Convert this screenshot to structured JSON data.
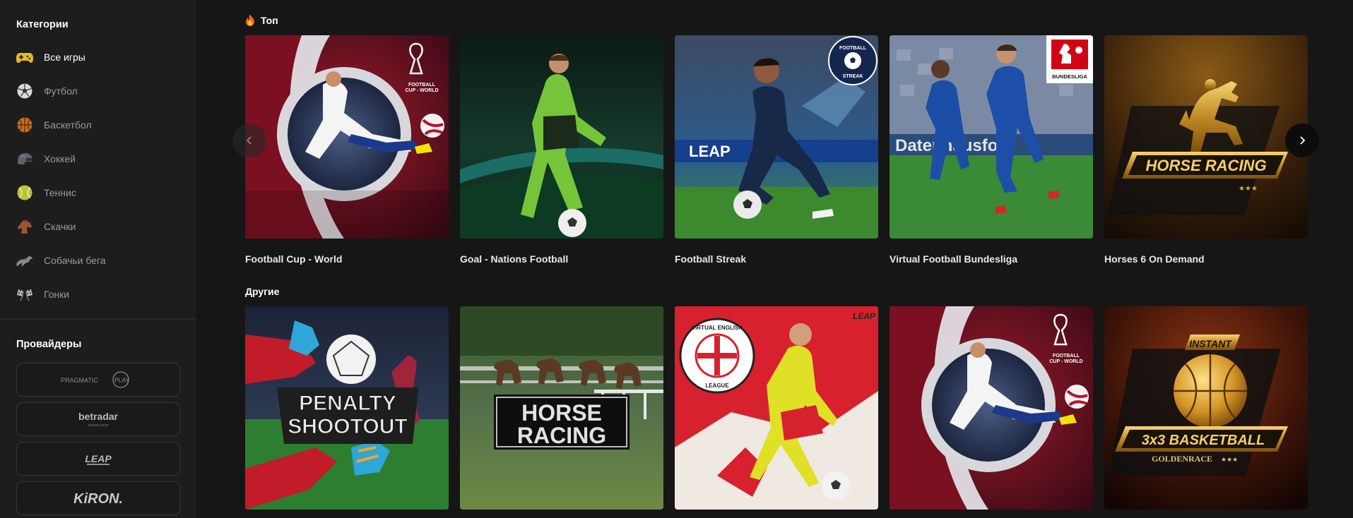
{
  "sidebar": {
    "categories_title": "Категории",
    "categories": [
      {
        "label": "Все игры",
        "icon": "gamepad-icon",
        "active": true
      },
      {
        "label": "Футбол",
        "icon": "soccer-ball-icon"
      },
      {
        "label": "Баскетбол",
        "icon": "basketball-icon"
      },
      {
        "label": "Хоккей",
        "icon": "hockey-helmet-icon"
      },
      {
        "label": "Теннис",
        "icon": "tennis-ball-icon"
      },
      {
        "label": "Скачки",
        "icon": "horse-head-icon"
      },
      {
        "label": "Собачьи бега",
        "icon": "greyhound-icon"
      },
      {
        "label": "Гонки",
        "icon": "racing-flags-icon"
      }
    ],
    "providers_title": "Провайдеры",
    "providers": [
      {
        "name": "PRAGMATIC PLAY",
        "logo_text": "PRAGMATIC",
        "logo_badge": "PLAY"
      },
      {
        "name": "betradar",
        "logo_text": "betradar",
        "logo_sub": "dreamy faces"
      },
      {
        "name": "LEAP",
        "logo_text": "LEAP"
      },
      {
        "name": "KIRON",
        "logo_text": "KiRON."
      }
    ]
  },
  "sections": {
    "top": {
      "title": "Топ",
      "icon": "fire-icon",
      "games": [
        {
          "title": "Football Cup - World",
          "badge": "FOOTBALL CUP - WORLD"
        },
        {
          "title": "Goal - Nations Football"
        },
        {
          "title": "Football Streak",
          "badge": "FOOTBALL STREAK"
        },
        {
          "title": "Virtual Football Bundesliga",
          "badge": "BUNDESLIGA"
        },
        {
          "title": "Horses 6 On Demand",
          "badge": "HORSE RACING"
        }
      ]
    },
    "other": {
      "title": "Другие",
      "games": [
        {
          "art_text": [
            "PENALTY",
            "SHOOTOUT"
          ]
        },
        {
          "art_text": [
            "HORSE",
            "RACING"
          ]
        },
        {
          "art_text": [
            "VIRTUAL ENGLISH LEAGUE",
            "LEAP"
          ]
        },
        {
          "badge": "FOOTBALL CUP - WORLD"
        },
        {
          "art_text": [
            "INSTANT",
            "3x3 BASKETBALL",
            "GOLDENRACE"
          ]
        }
      ]
    }
  },
  "carousel": {
    "prev_icon": "chevron-left-icon",
    "next_icon": "chevron-right-icon"
  },
  "colors": {
    "background": "#161616",
    "sidebar": "#1d1d1d",
    "text_muted": "#9a9a9a",
    "accent_gold": "#d4a23a"
  }
}
